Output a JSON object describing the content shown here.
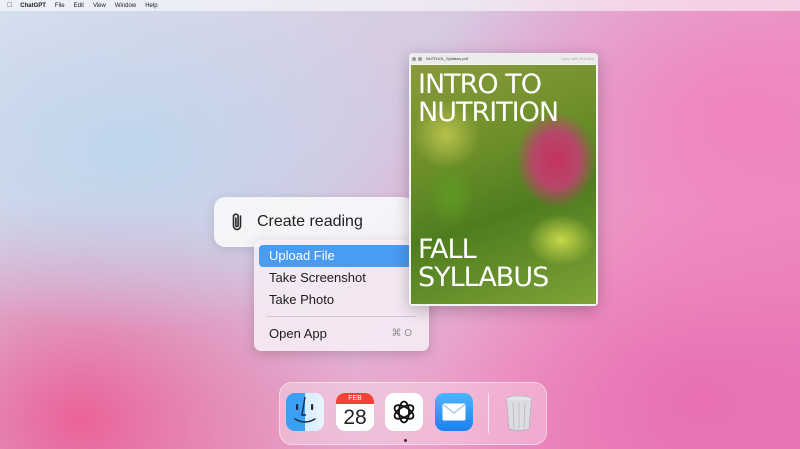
{
  "menubar": {
    "apple_icon": "apple-logo-icon",
    "app_name": "ChatGPT",
    "items": [
      "File",
      "Edit",
      "View",
      "Window",
      "Help"
    ]
  },
  "attach_bar": {
    "icon": "paperclip-icon",
    "label": "Create reading"
  },
  "dropdown": {
    "items": [
      {
        "label": "Upload File",
        "highlighted": true
      },
      {
        "label": "Take Screenshot"
      },
      {
        "label": "Take Photo"
      }
    ],
    "open_app": {
      "label": "Open App",
      "shortcut": "⌘ O"
    },
    "highlight_color": "#4a9bf2"
  },
  "pdf_window": {
    "filename": "NUTR101_Syllabus.pdf",
    "open_with": "Open with Preview",
    "title_line1": "INTRO TO",
    "title_line2": "NUTRITION",
    "subtitle_line1": "FALL",
    "subtitle_line2": "SYLLABUS"
  },
  "dock": {
    "apps": [
      {
        "name": "Finder",
        "icon": "finder-icon"
      },
      {
        "name": "Calendar",
        "icon": "calendar-icon",
        "month": "FEB",
        "day": "28"
      },
      {
        "name": "ChatGPT",
        "icon": "chatgpt-icon",
        "running": true
      },
      {
        "name": "Mail",
        "icon": "mail-icon"
      },
      {
        "name": "Trash",
        "icon": "trash-icon"
      }
    ]
  }
}
